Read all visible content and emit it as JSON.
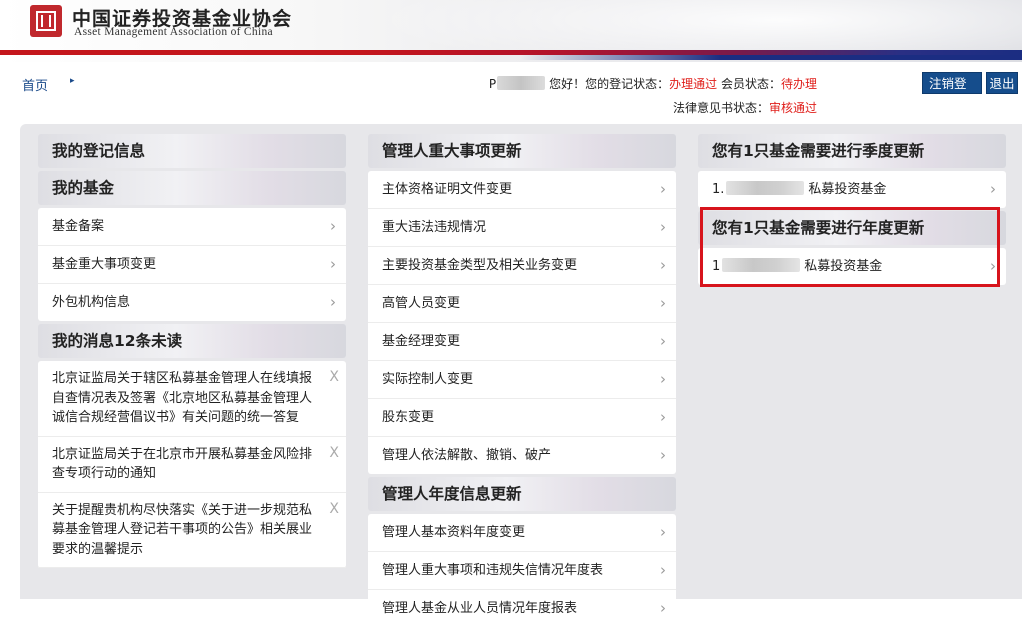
{
  "header": {
    "org_name_cn": "中国证券投资基金业协会",
    "org_name_en": "Asset Management Association of China"
  },
  "topbar": {
    "home": "首页",
    "user_prefix": "P",
    "greeting": "您好！您的登记状态：",
    "reg_status": "办理通过",
    "member_label": "会员状态：",
    "member_status": "待办理",
    "legal_label": "法律意见书状态：",
    "legal_status": "审核通过",
    "cancel_btn": "注销登记",
    "logout_btn": "退出"
  },
  "col1": {
    "reg_info": "我的登记信息",
    "my_funds": "我的基金",
    "fund_items": [
      "基金备案",
      "基金重大事项变更",
      "外包机构信息"
    ],
    "messages_title": "我的消息12条未读",
    "messages": [
      "北京证监局关于辖区私募基金管理人在线填报自查情况表及签署《北京地区私募基金管理人诚信合规经营倡议书》有关问题的统一答复",
      "北京证监局关于在北京市开展私募基金风险排查专项行动的通知",
      "关于提醒贵机构尽快落实《关于进一步规范私募基金管理人登记若干事项的公告》相关展业要求的温馨提示"
    ],
    "close_glyph": "X"
  },
  "col2": {
    "major_title": "管理人重大事项更新",
    "major_items": [
      "主体资格证明文件变更",
      "重大违法违规情况",
      "主要投资基金类型及相关业务变更",
      "高管人员变更",
      "基金经理变更",
      "实际控制人变更",
      "股东变更",
      "管理人依法解散、撤销、破产"
    ],
    "annual_title": "管理人年度信息更新",
    "annual_items": [
      "管理人基本资料年度变更",
      "管理人重大事项和违规失信情况年度表",
      "管理人基金从业人员情况年度报表"
    ]
  },
  "col3": {
    "quarterly_title": "您有1只基金需要进行季度更新",
    "quarterly_prefix": "1.",
    "quarterly_suffix": "私募投资基金",
    "annual_title": "您有1只基金需要进行年度更新",
    "annual_prefix": "1",
    "annual_suffix": "私募投资基金"
  },
  "colors": {
    "accent_red": "#d7141c",
    "button_blue": "#154d8c",
    "link_blue": "#1a4a8a"
  }
}
